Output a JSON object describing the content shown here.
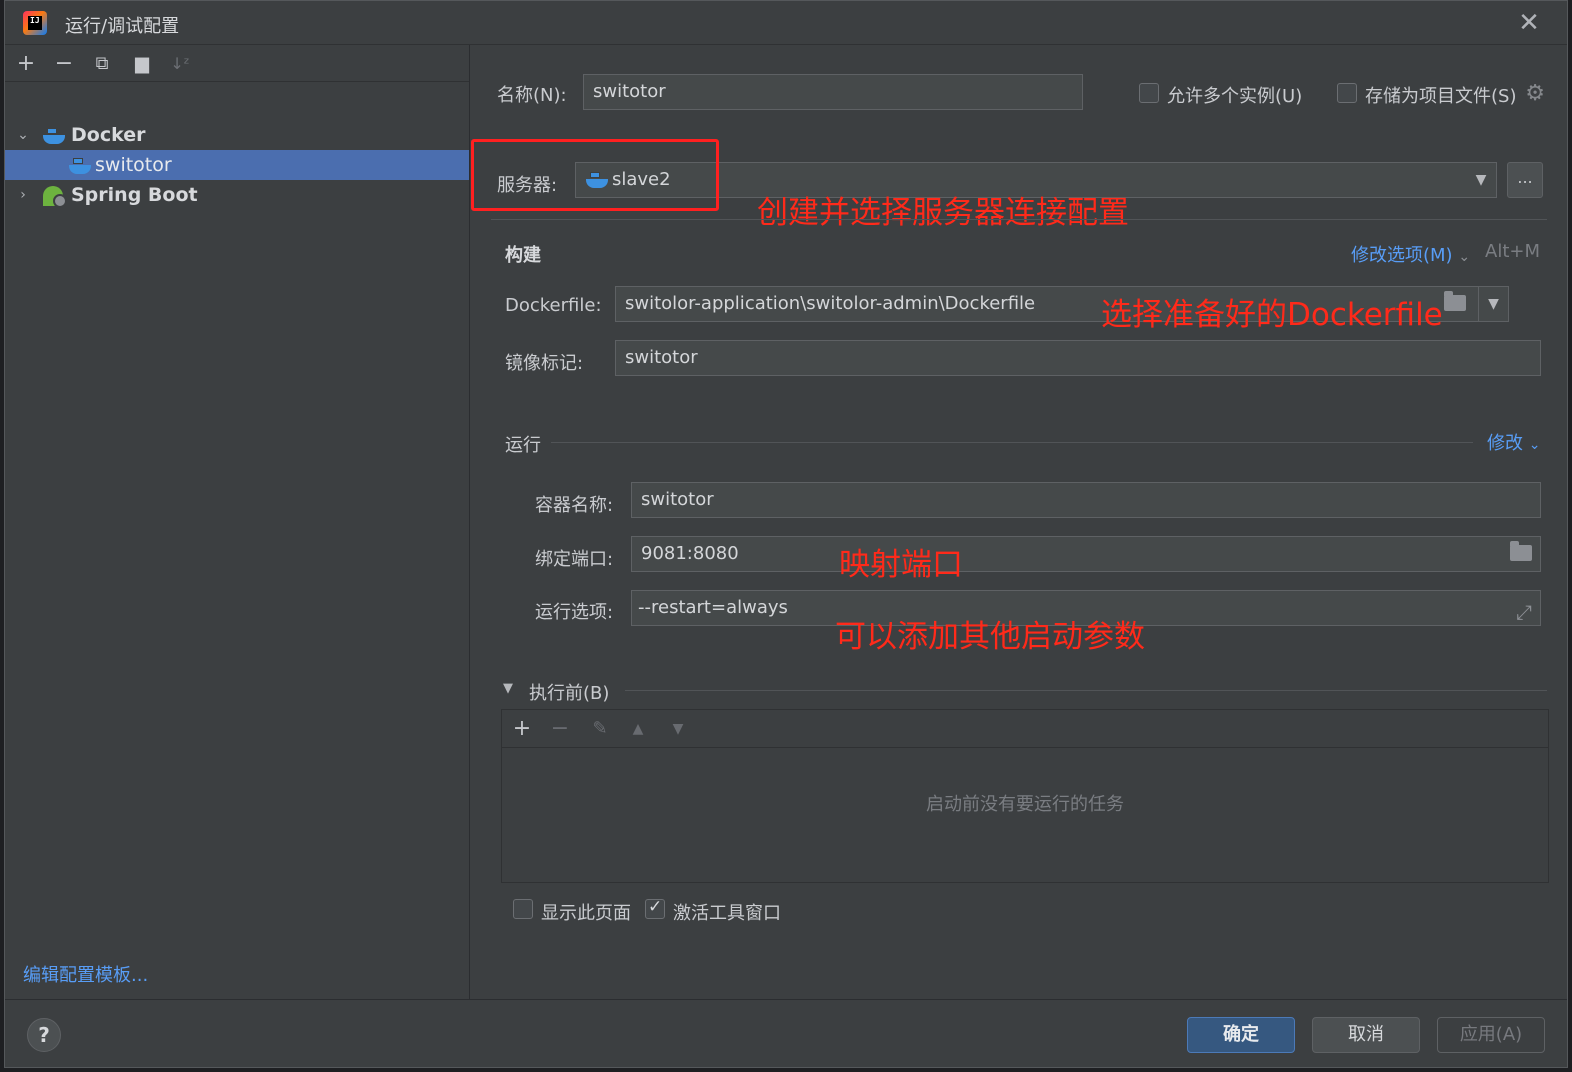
{
  "window": {
    "title": "运行/调试配置"
  },
  "left": {
    "toolbar": [
      "add-icon",
      "remove-icon",
      "copy-icon",
      "new-folder-icon",
      "sort-icon"
    ],
    "tree": [
      {
        "label": "Docker",
        "expanded": true,
        "bold": true
      },
      {
        "label": "switotor",
        "selected": true
      },
      {
        "label": "Spring Boot",
        "expanded": false,
        "bold": true
      }
    ],
    "edit_templates": "编辑配置模板..."
  },
  "form": {
    "name_label": "名称(N):",
    "name_value": "switotor",
    "allow_multiple": "允许多个实例(U)",
    "store_as_file": "存储为项目文件(S)",
    "server_label": "服务器:",
    "server_value": "slave2",
    "server_more": "...",
    "build_title": "构建",
    "modify_options": "修改选项(M)",
    "modify_shortcut": "Alt+M",
    "dockerfile_label": "Dockerfile:",
    "dockerfile_value": "switolor-application\\switolor-admin\\Dockerfile",
    "image_tag_label": "镜像标记:",
    "image_tag_value": "switotor",
    "run_title": "运行",
    "run_modify": "修改",
    "container_label": "容器名称:",
    "container_value": "switotor",
    "ports_label": "绑定端口:",
    "ports_value": "9081:8080",
    "run_options_label": "运行选项:",
    "run_options_value": "--restart=always",
    "before_launch": "执行前(B)",
    "no_tasks": "启动前没有要运行的任务",
    "show_page": "显示此页面",
    "activate_tool": "激活工具窗口"
  },
  "annotations": {
    "server": "创建并选择服务器连接配置",
    "dockerfile": "选择准备好的Dockerfile",
    "ports": "映射端口",
    "run_options": "可以添加其他启动参数"
  },
  "buttons": {
    "help": "?",
    "ok": "确定",
    "cancel": "取消",
    "apply": "应用(A)"
  },
  "colors": {
    "accent": "#4b6eaf",
    "link": "#589df6",
    "annotation": "#ff2a1a"
  }
}
